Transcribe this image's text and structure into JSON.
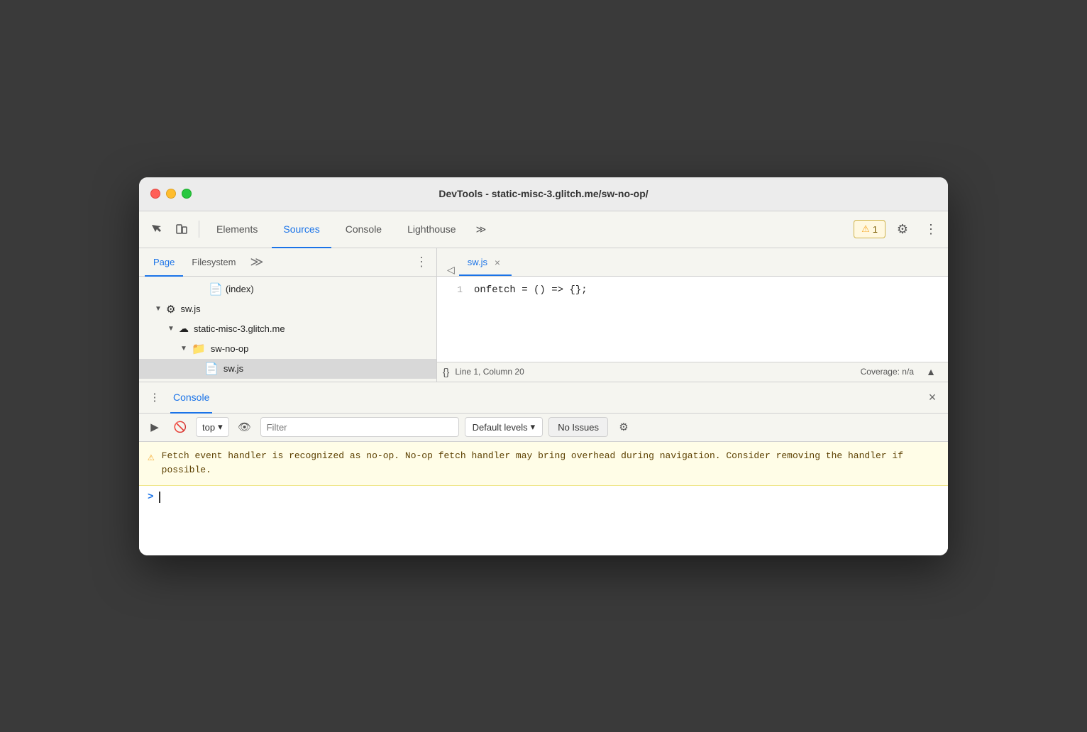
{
  "window": {
    "title": "DevTools - static-misc-3.glitch.me/sw-no-op/"
  },
  "top_toolbar": {
    "tabs": [
      {
        "id": "elements",
        "label": "Elements",
        "active": false
      },
      {
        "id": "sources",
        "label": "Sources",
        "active": true
      },
      {
        "id": "console",
        "label": "Console",
        "active": false
      },
      {
        "id": "lighthouse",
        "label": "Lighthouse",
        "active": false
      }
    ],
    "more_tabs_icon": "≫",
    "warning_count": "1",
    "gear_icon": "⚙",
    "more_icon": "⋮"
  },
  "left_panel": {
    "tabs": [
      {
        "id": "page",
        "label": "Page",
        "active": true
      },
      {
        "id": "filesystem",
        "label": "Filesystem",
        "active": false
      }
    ],
    "more_tabs": "≫",
    "options_icon": "⋮",
    "file_tree": [
      {
        "id": "index",
        "indent": 120,
        "arrow": "",
        "icon": "📄",
        "label": "(index)",
        "selected": false
      },
      {
        "id": "swjs-root",
        "indent": 30,
        "arrow": "▼",
        "icon": "⚙",
        "label": "sw.js",
        "selected": false
      },
      {
        "id": "domain",
        "indent": 50,
        "arrow": "▼",
        "icon": "☁",
        "label": "static-misc-3.glitch.me",
        "selected": false
      },
      {
        "id": "folder",
        "indent": 70,
        "arrow": "▼",
        "icon": "📁",
        "label": "sw-no-op",
        "selected": false
      },
      {
        "id": "swjs-file",
        "indent": 90,
        "arrow": "",
        "icon": "📄",
        "label": "sw.js",
        "selected": true
      }
    ]
  },
  "editor": {
    "active_file": "sw.js",
    "close_icon": "×",
    "code_lines": [
      {
        "number": "1",
        "content": "onfetch = () => {};"
      }
    ],
    "status_bar": {
      "format_icon": "{}",
      "position": "Line 1, Column 20",
      "coverage": "Coverage: n/a"
    }
  },
  "console_panel": {
    "title": "Console",
    "close_icon": "×",
    "toolbar": {
      "run_icon": "▶",
      "block_icon": "🚫",
      "context_selector": "top",
      "context_arrow": "▾",
      "eye_icon": "👁",
      "filter_placeholder": "Filter",
      "default_levels": "Default levels",
      "default_levels_arrow": "▾",
      "no_issues": "No Issues",
      "settings_icon": "⚙"
    },
    "messages": [
      {
        "type": "warning",
        "text": "Fetch event handler is recognized as no-op. No-op fetch handler may bring overhead during navigation. Consider removing the handler if possible."
      }
    ],
    "prompt": ">"
  }
}
